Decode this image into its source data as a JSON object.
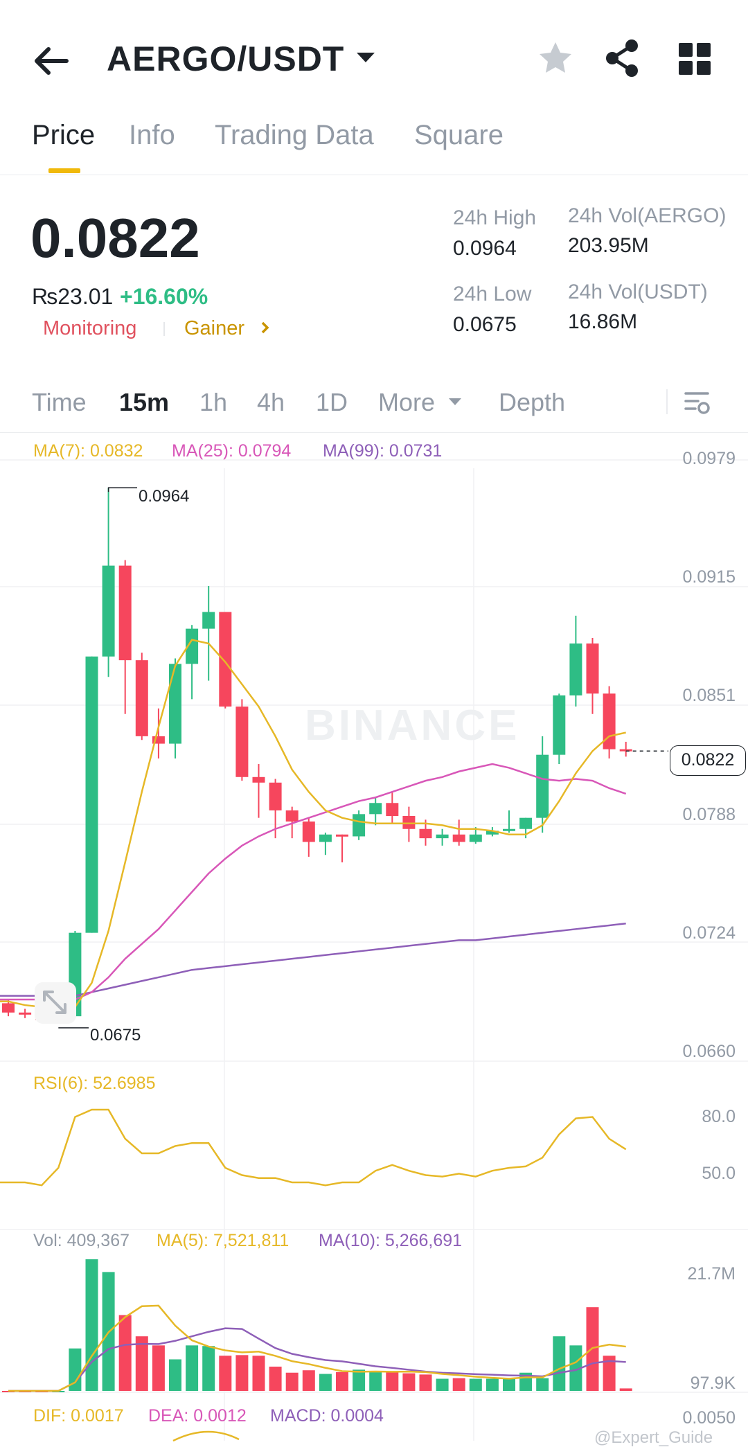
{
  "header": {
    "back_icon": "arrow-left-icon",
    "pair": "AERGO/USDT",
    "dropdown_icon": "caret-down-icon",
    "icons": [
      "star-icon",
      "share-icon",
      "grid-icon"
    ]
  },
  "tabs": [
    {
      "label": "Price",
      "active": true
    },
    {
      "label": "Info"
    },
    {
      "label": "Trading Data"
    },
    {
      "label": "Square"
    }
  ],
  "price": {
    "last": "0.0822",
    "fiat": "₨23.01",
    "change": "+16.60%",
    "tag_monitoring": "Monitoring",
    "tag_gainer": "Gainer",
    "gainer_icon": "chevron-right-icon"
  },
  "stats": {
    "high_label": "24h High",
    "high_value": "0.0964",
    "low_label": "24h Low",
    "low_value": "0.0675",
    "vol_base_label": "24h Vol(AERGO)",
    "vol_base_value": "203.95M",
    "vol_quote_label": "24h Vol(USDT)",
    "vol_quote_value": "16.86M"
  },
  "timeframes": {
    "items": [
      "Time",
      "15m",
      "1h",
      "4h",
      "1D"
    ],
    "active": "15m",
    "more_label": "More",
    "depth_label": "Depth",
    "settings_icon": "chart-settings-icon"
  },
  "indicators": {
    "ma7": "MA(7): 0.0832",
    "ma25": "MA(25): 0.0794",
    "ma99": "MA(99): 0.0731",
    "rsi": "RSI(6): 52.6985",
    "vol": "Vol: 409,367",
    "vol_ma5": "MA(5): 7,521,811",
    "vol_ma10": "MA(10): 5,266,691",
    "dif": "DIF: 0.0017",
    "dea": "DEA: 0.0012",
    "macd": "MACD: 0.0004"
  },
  "axes": {
    "price_ticks": [
      "0.0979",
      "0.0915",
      "0.0851",
      "0.0788",
      "0.0724",
      "0.0660"
    ],
    "current_price_tag": "0.0822",
    "high_marker": "0.0964",
    "low_marker": "0.0675",
    "rsi_ticks": [
      "80.0",
      "50.0"
    ],
    "vol_ticks": [
      "21.7M",
      "97.9K"
    ],
    "macd_tick": "0.0050"
  },
  "watermark": "BINANCE",
  "credit": "@Expert_Guide",
  "colors": {
    "up": "#2ebd85",
    "down": "#f6465d",
    "accent": "#f0b90b",
    "ma7": "#e6b827",
    "ma25": "#d857b8",
    "ma99": "#8e5fb8"
  },
  "chart_data": {
    "type": "candlestick",
    "interval": "15m",
    "price_range": [
      0.066,
      0.0979
    ],
    "candles": [
      {
        "o": 0.0686,
        "h": 0.0688,
        "l": 0.0679,
        "c": 0.0681
      },
      {
        "o": 0.0681,
        "h": 0.0683,
        "l": 0.0678,
        "c": 0.068
      },
      {
        "o": 0.068,
        "h": 0.0682,
        "l": 0.0676,
        "c": 0.0677
      },
      {
        "o": 0.0677,
        "h": 0.068,
        "l": 0.0675,
        "c": 0.0679
      },
      {
        "o": 0.0679,
        "h": 0.0725,
        "l": 0.0678,
        "c": 0.0724
      },
      {
        "o": 0.0724,
        "h": 0.0865,
        "l": 0.0724,
        "c": 0.0873
      },
      {
        "o": 0.0873,
        "h": 0.0964,
        "l": 0.0862,
        "c": 0.0922
      },
      {
        "o": 0.0922,
        "h": 0.0925,
        "l": 0.0842,
        "c": 0.0871
      },
      {
        "o": 0.0871,
        "h": 0.0875,
        "l": 0.0828,
        "c": 0.083
      },
      {
        "o": 0.083,
        "h": 0.0845,
        "l": 0.0818,
        "c": 0.0826
      },
      {
        "o": 0.0826,
        "h": 0.0872,
        "l": 0.0818,
        "c": 0.0869
      },
      {
        "o": 0.0869,
        "h": 0.089,
        "l": 0.085,
        "c": 0.0888
      },
      {
        "o": 0.0888,
        "h": 0.0911,
        "l": 0.086,
        "c": 0.0897
      },
      {
        "o": 0.0897,
        "h": 0.0897,
        "l": 0.0845,
        "c": 0.0846
      },
      {
        "o": 0.0846,
        "h": 0.085,
        "l": 0.0806,
        "c": 0.0808
      },
      {
        "o": 0.0808,
        "h": 0.0815,
        "l": 0.0786,
        "c": 0.0805
      },
      {
        "o": 0.0805,
        "h": 0.0807,
        "l": 0.0775,
        "c": 0.079
      },
      {
        "o": 0.079,
        "h": 0.0792,
        "l": 0.0775,
        "c": 0.0784
      },
      {
        "o": 0.0784,
        "h": 0.0786,
        "l": 0.0765,
        "c": 0.0773
      },
      {
        "o": 0.0773,
        "h": 0.0778,
        "l": 0.0766,
        "c": 0.0777
      },
      {
        "o": 0.0777,
        "h": 0.0776,
        "l": 0.0762,
        "c": 0.0776
      },
      {
        "o": 0.0776,
        "h": 0.079,
        "l": 0.0774,
        "c": 0.0788
      },
      {
        "o": 0.0788,
        "h": 0.0797,
        "l": 0.0782,
        "c": 0.0794
      },
      {
        "o": 0.0794,
        "h": 0.08,
        "l": 0.0783,
        "c": 0.0787
      },
      {
        "o": 0.0787,
        "h": 0.0792,
        "l": 0.0773,
        "c": 0.078
      },
      {
        "o": 0.078,
        "h": 0.0785,
        "l": 0.0771,
        "c": 0.0775
      },
      {
        "o": 0.0775,
        "h": 0.078,
        "l": 0.0771,
        "c": 0.0777
      },
      {
        "o": 0.0777,
        "h": 0.0785,
        "l": 0.0771,
        "c": 0.0773
      },
      {
        "o": 0.0773,
        "h": 0.0781,
        "l": 0.0772,
        "c": 0.0777
      },
      {
        "o": 0.0777,
        "h": 0.0781,
        "l": 0.0776,
        "c": 0.0779
      },
      {
        "o": 0.0779,
        "h": 0.079,
        "l": 0.0778,
        "c": 0.078
      },
      {
        "o": 0.078,
        "h": 0.0786,
        "l": 0.0775,
        "c": 0.0786
      },
      {
        "o": 0.0786,
        "h": 0.083,
        "l": 0.0778,
        "c": 0.082
      },
      {
        "o": 0.082,
        "h": 0.0853,
        "l": 0.0815,
        "c": 0.0852
      },
      {
        "o": 0.0852,
        "h": 0.0895,
        "l": 0.0846,
        "c": 0.088
      },
      {
        "o": 0.088,
        "h": 0.0883,
        "l": 0.0842,
        "c": 0.0853
      },
      {
        "o": 0.0853,
        "h": 0.0857,
        "l": 0.0818,
        "c": 0.0823
      },
      {
        "o": 0.0823,
        "h": 0.0827,
        "l": 0.0819,
        "c": 0.0822
      }
    ],
    "ma7": [
      0.0687,
      0.0685,
      0.0684,
      0.0683,
      0.0684,
      0.0697,
      0.0725,
      0.0762,
      0.08,
      0.0835,
      0.0868,
      0.0882,
      0.088,
      0.087,
      0.0858,
      0.0846,
      0.083,
      0.0812,
      0.08,
      0.079,
      0.0786,
      0.0784,
      0.0783,
      0.0783,
      0.0783,
      0.0783,
      0.0782,
      0.078,
      0.078,
      0.0779,
      0.0777,
      0.0777,
      0.0782,
      0.0795,
      0.081,
      0.0822,
      0.083,
      0.0832
    ],
    "ma25": [
      0.0688,
      0.0688,
      0.0688,
      0.0688,
      0.0688,
      0.0692,
      0.07,
      0.071,
      0.0718,
      0.0726,
      0.0736,
      0.0746,
      0.0756,
      0.0764,
      0.0771,
      0.0776,
      0.078,
      0.0783,
      0.0786,
      0.0789,
      0.0792,
      0.0795,
      0.0797,
      0.08,
      0.0803,
      0.0806,
      0.0808,
      0.0811,
      0.0813,
      0.0815,
      0.0813,
      0.081,
      0.0807,
      0.0806,
      0.0807,
      0.0806,
      0.0802,
      0.0799
    ],
    "ma99": [
      0.069,
      0.069,
      0.069,
      0.069,
      0.069,
      0.0692,
      0.0694,
      0.0696,
      0.0698,
      0.07,
      0.0702,
      0.0704,
      0.0705,
      0.0706,
      0.0707,
      0.0708,
      0.0709,
      0.071,
      0.0711,
      0.0712,
      0.0713,
      0.0714,
      0.0715,
      0.0716,
      0.0717,
      0.0718,
      0.0719,
      0.072,
      0.072,
      0.0721,
      0.0722,
      0.0723,
      0.0724,
      0.0725,
      0.0726,
      0.0727,
      0.0728,
      0.0729
    ],
    "rsi": {
      "range": [
        0,
        100
      ],
      "values": [
        30,
        30,
        28,
        40,
        75,
        80,
        80,
        60,
        50,
        50,
        55,
        57,
        57,
        40,
        35,
        33,
        33,
        30,
        30,
        28,
        30,
        30,
        38,
        42,
        38,
        35,
        34,
        36,
        34,
        38,
        40,
        41,
        47,
        63,
        74,
        75,
        60,
        52.7
      ]
    },
    "volume": {
      "range": [
        0,
        21700000
      ],
      "values": [
        0,
        0,
        0,
        0,
        7000000,
        21700000,
        19600000,
        12500000,
        9000000,
        7500000,
        5200000,
        7500000,
        7400000,
        5800000,
        5900000,
        5800000,
        4000000,
        3000000,
        3400000,
        2800000,
        3100000,
        3500000,
        3200000,
        3200000,
        2900000,
        2700000,
        2000000,
        2100000,
        2000000,
        2000000,
        2000000,
        3000000,
        2100000,
        9000000,
        7500000,
        13800000,
        5800000,
        409367
      ]
    }
  }
}
